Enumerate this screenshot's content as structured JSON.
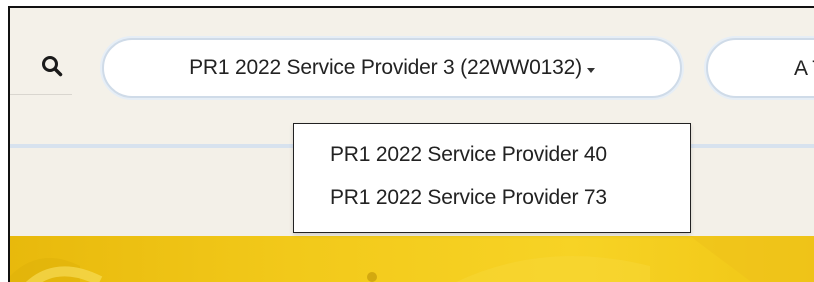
{
  "search": {
    "icon": "search-icon"
  },
  "provider_selector": {
    "selected_label": "PR1 2022 Service Provider 3 (22WW0132)",
    "caret_icon": "caret-down-icon"
  },
  "secondary_selector": {
    "label": "A T"
  },
  "dropdown": {
    "options": [
      {
        "label": "PR1 2022 Service Provider 40"
      },
      {
        "label": "PR1 2022 Service Provider 73"
      }
    ]
  },
  "colors": {
    "page_background": "#f3f0e8",
    "pill_border": "#cfdbe8",
    "divider": "#d7e2ee",
    "banner_yellow": "#f2c91a"
  }
}
